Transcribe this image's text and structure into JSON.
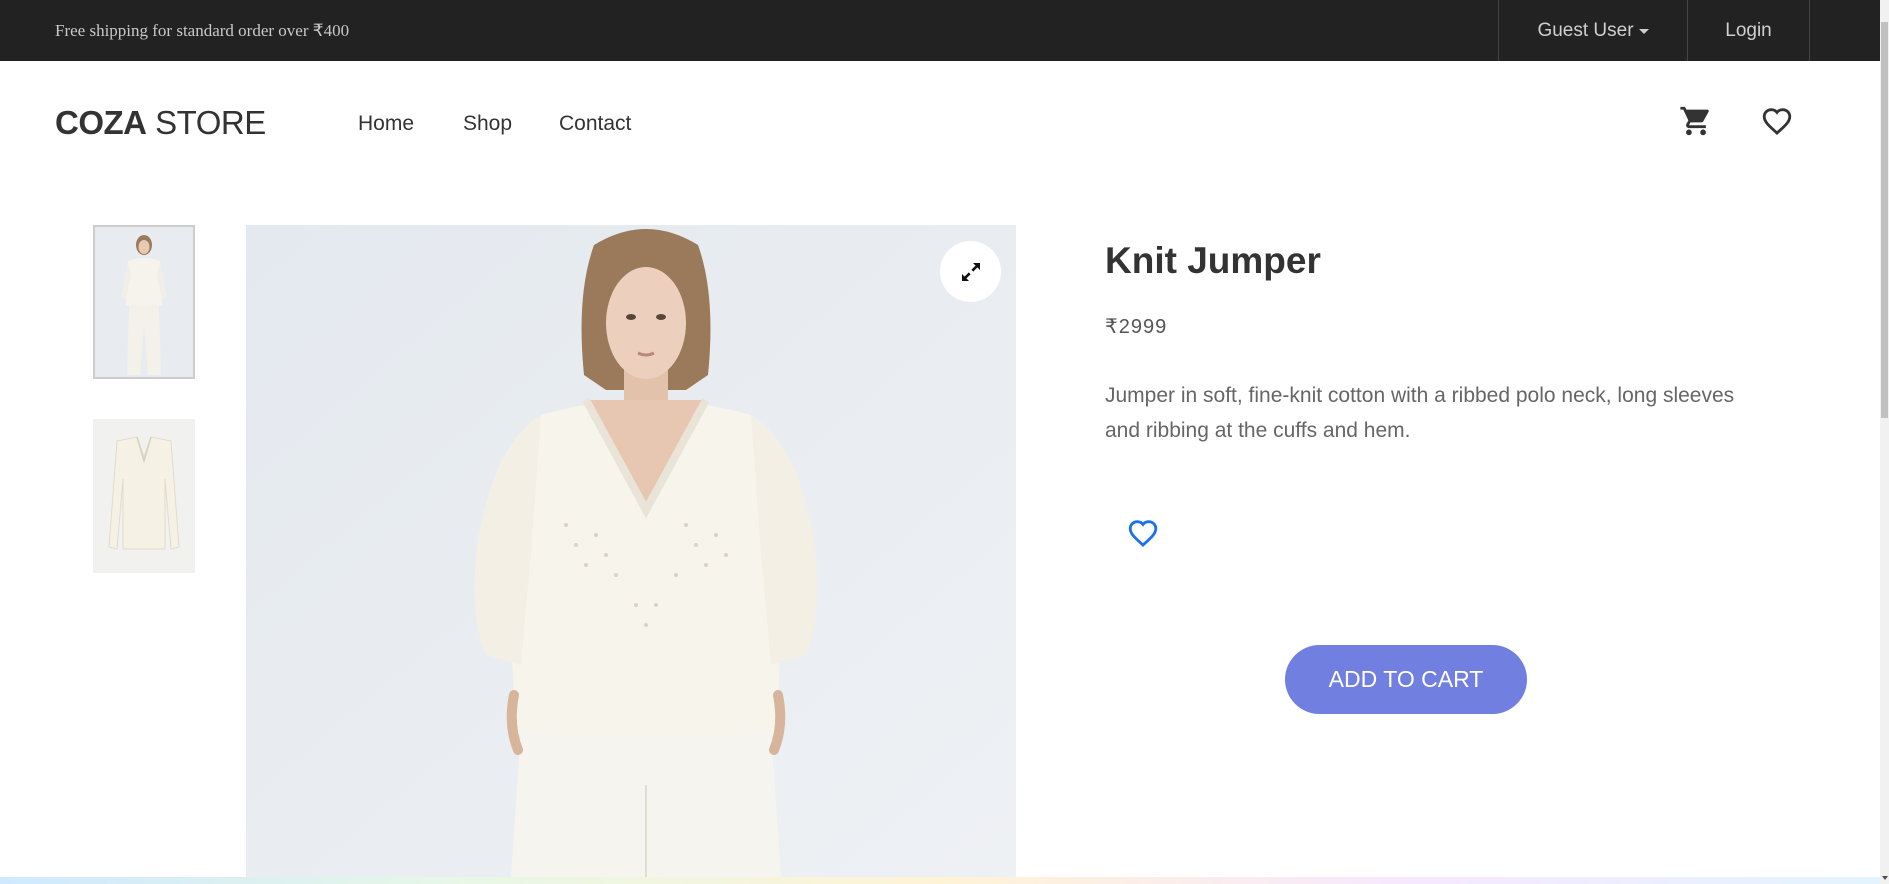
{
  "topbar": {
    "promo": "Free shipping for standard order over ₹400",
    "guest_user": "Guest User",
    "login": "Login"
  },
  "header": {
    "logo_bold": "COZA",
    "logo_light": " STORE",
    "nav": [
      {
        "label": "Home"
      },
      {
        "label": "Shop"
      },
      {
        "label": "Contact"
      }
    ],
    "icons": [
      "cart-icon",
      "heart-icon"
    ]
  },
  "product": {
    "title": "Knit Jumper",
    "price": "₹2999",
    "description": "Jumper in soft, fine-knit cotton with a ribbed polo neck, long sleeves and ribbing at the cuffs and hem.",
    "add_to_cart": "ADD TO CART"
  },
  "colors": {
    "topbar_bg": "#222222",
    "accent": "#717fe0",
    "wishlist_blue": "#1a73e8",
    "text_dark": "#333333"
  }
}
